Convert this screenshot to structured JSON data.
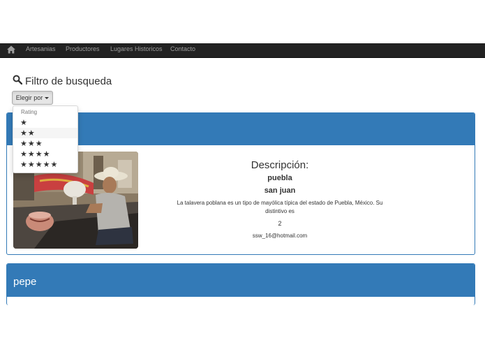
{
  "navbar": {
    "home_icon": "home-icon",
    "links": [
      "Artesanias",
      "Productores",
      "Lugares Historicos",
      "Contacto"
    ]
  },
  "filter": {
    "title": "Filtro de busqueda",
    "icon": "search-icon",
    "button_label": "Elegir por"
  },
  "dropdown": {
    "header": "Rating",
    "items": [
      "★",
      "★★",
      "★★★",
      "★★★★",
      "★★★★★"
    ]
  },
  "card1": {
    "description_title": "Descripción:",
    "state": "puebla",
    "place": "san juan",
    "description": "La talavera poblana es un tipo de mayólica típica del estado de Puebla, México. Su distintivo es",
    "number": "2",
    "email": "ssw_16@hotmail.com"
  },
  "card2": {
    "title": "pepe"
  },
  "colors": {
    "navbar": "#222222",
    "panel_primary": "#337ab7"
  }
}
